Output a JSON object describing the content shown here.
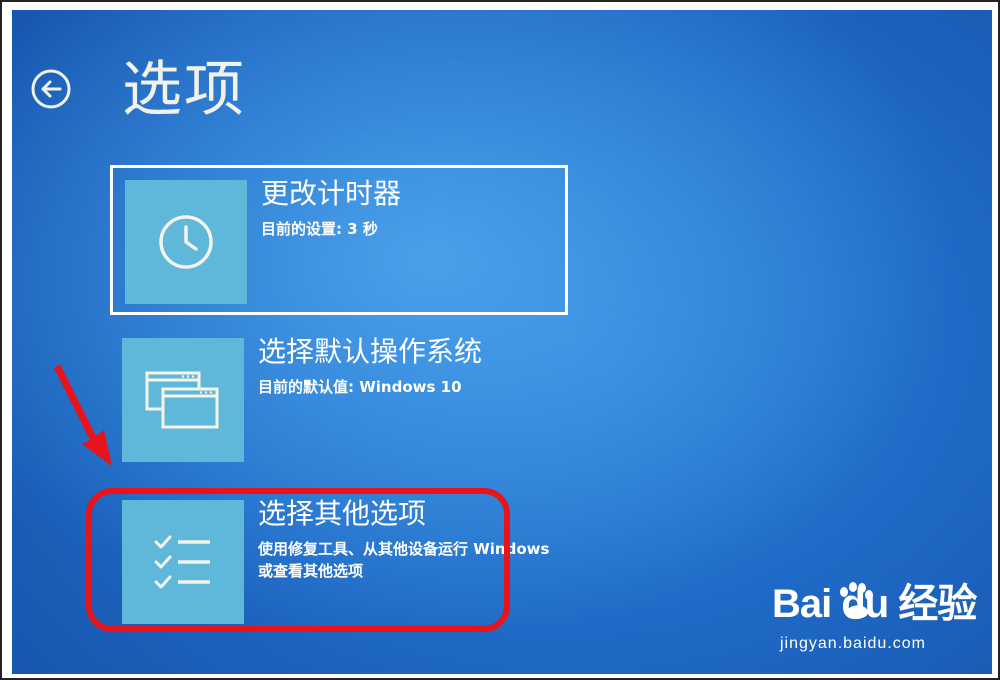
{
  "page": {
    "title": "选项"
  },
  "options": [
    {
      "title": "更改计时器",
      "description": "目前的设置: 3 秒",
      "icon": "clock-icon"
    },
    {
      "title": "选择默认操作系统",
      "description": "目前的默认值: Windows 10",
      "icon": "windows-stack-icon"
    },
    {
      "title": "选择其他选项",
      "description": "使用修复工具、从其他设备运行 Windows 或查看其他选项",
      "icon": "checklist-icon"
    }
  ],
  "watermark": {
    "brand": "Bai du 经验",
    "url": "jingyan.baidu.com"
  },
  "colors": {
    "background": "#1f6ac6",
    "tile": "#5fb7d9",
    "highlight": "#e8131b",
    "text": "#ffffff"
  }
}
